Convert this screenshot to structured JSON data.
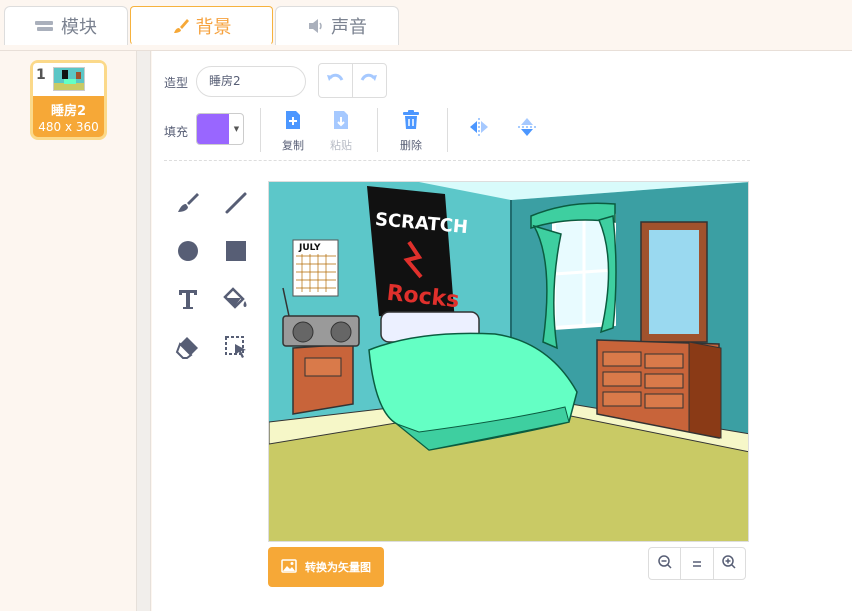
{
  "tabs": [
    {
      "label": "模块",
      "icon": "blocks-icon"
    },
    {
      "label": "背景",
      "icon": "paintbrush-icon",
      "active": true
    },
    {
      "label": "声音",
      "icon": "speaker-icon"
    }
  ],
  "costume": {
    "number": "1",
    "name": "睡房2",
    "size": "480 x 360"
  },
  "editor": {
    "costume_label": "造型",
    "costume_name": "睡房2",
    "fill_label": "填充",
    "fill_color": "#9966ff",
    "copy_label": "复制",
    "paste_label": "粘贴",
    "delete_label": "删除"
  },
  "canvas": {
    "poster_line1": "SCRATCH",
    "poster_line2": "Rocks",
    "calendar_month": "JULY"
  },
  "footer": {
    "convert_label": "转换为矢量图"
  },
  "colors": {
    "accent": "#f6a837",
    "blue": "#4c97ff",
    "text": "#575e75"
  }
}
